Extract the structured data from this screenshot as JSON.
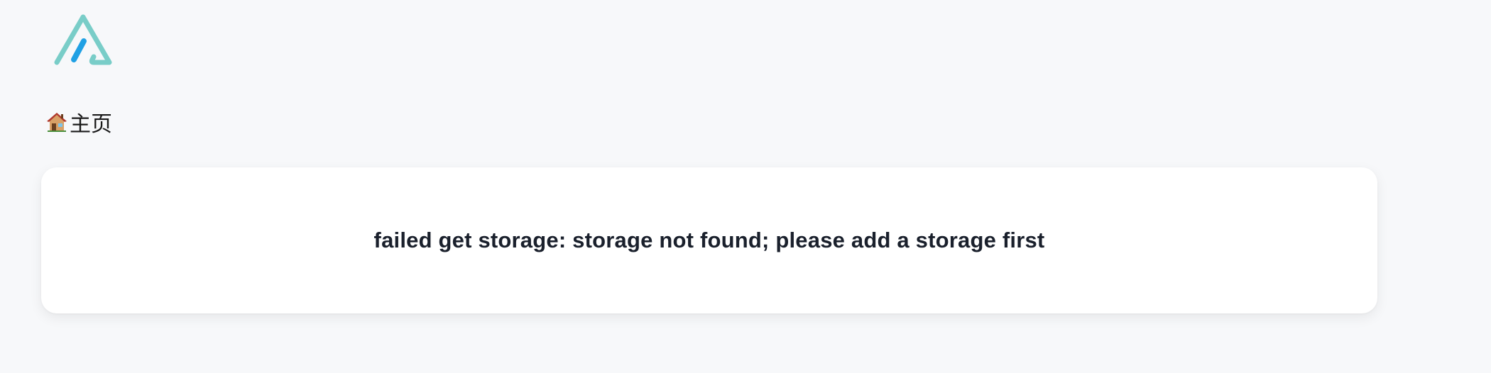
{
  "header": {
    "logo_icon": "alist-triangle-logo-icon",
    "colors": {
      "logo_teal": "#79cdc8",
      "logo_blue": "#1fa0e4"
    }
  },
  "breadcrumb": {
    "home_icon": "house-emoji-icon",
    "home_label": "主页"
  },
  "main": {
    "error_message": "failed get storage: storage not found; please add a storage first"
  }
}
